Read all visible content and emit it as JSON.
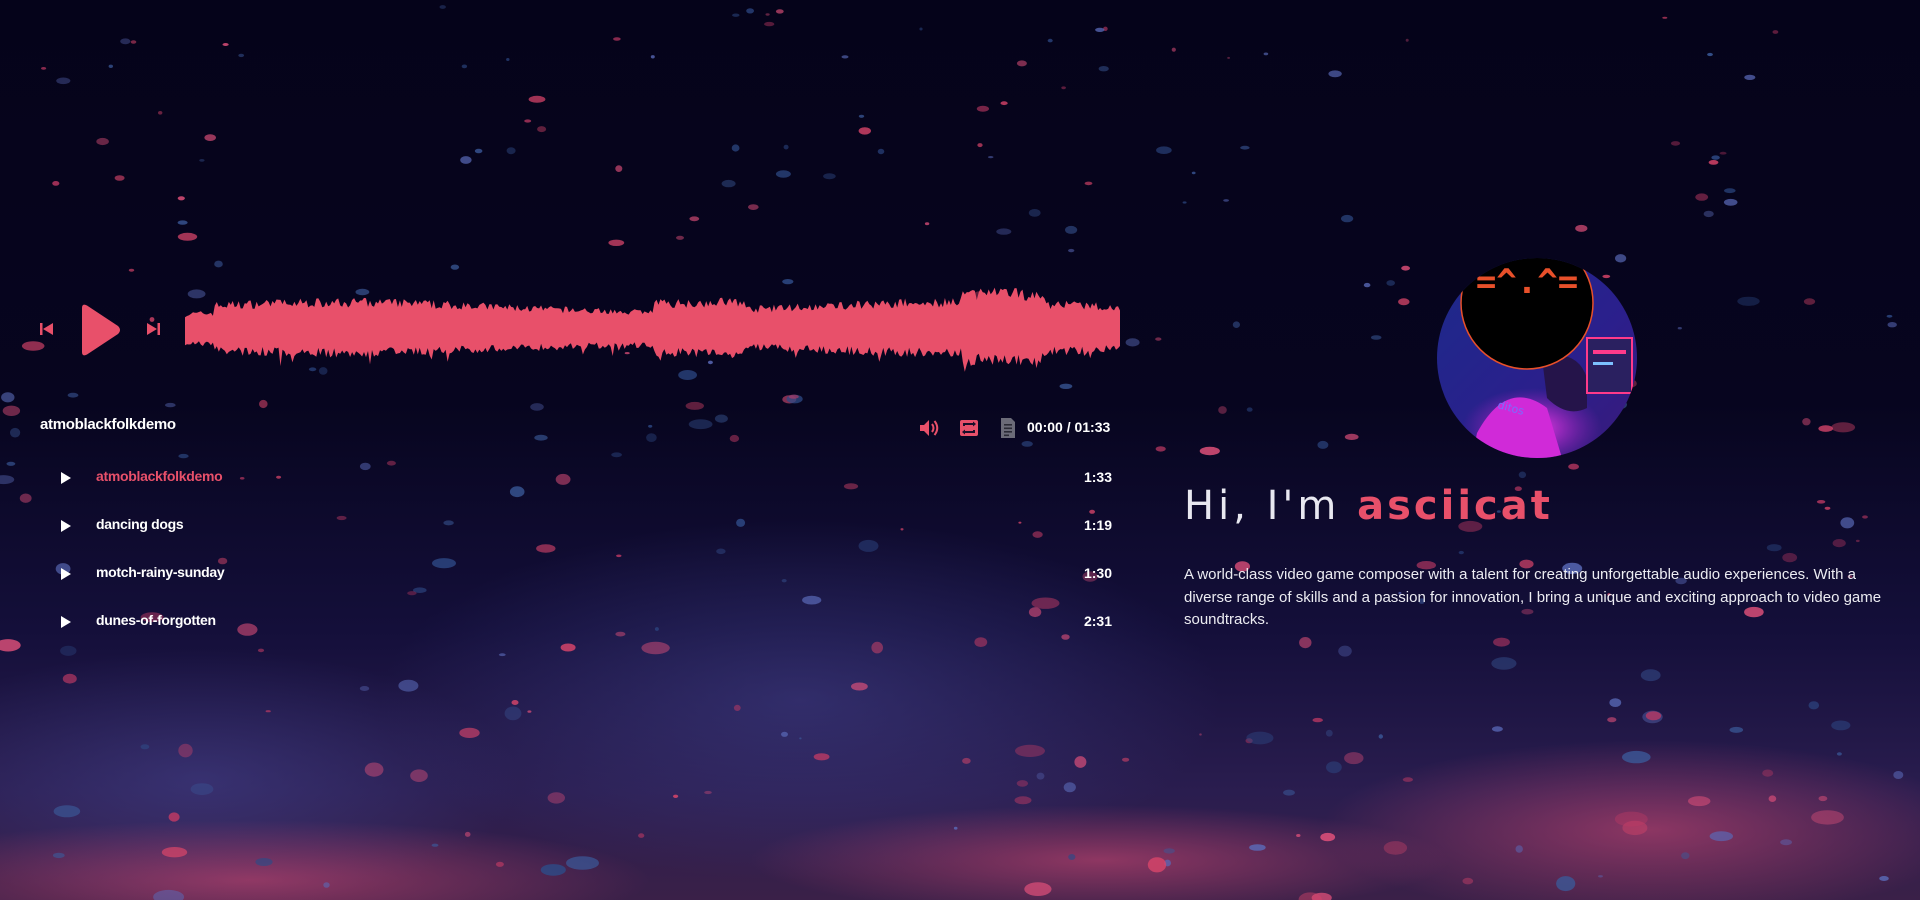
{
  "player": {
    "current_track": "atmoblackfolkdemo",
    "time_current": "00:00",
    "time_total": "01:33",
    "accent_color": "#e8506a"
  },
  "playlist": [
    {
      "title": "atmoblackfolkdemo",
      "duration": "1:33",
      "active": true
    },
    {
      "title": "dancing dogs",
      "duration": "1:19",
      "active": false
    },
    {
      "title": "motch-rainy-sunday",
      "duration": "1:30",
      "active": false
    },
    {
      "title": "dunes-of-forgotten",
      "duration": "2:31",
      "active": false
    }
  ],
  "profile": {
    "greeting": "Hi, I'm",
    "name": "asciicat",
    "avatar_logo": "=^.^=",
    "bio": "A world-class video game composer with a talent for creating unforgettable audio experiences. With a diverse range of skills and a passion for innovation, I bring a unique and exciting approach to video game soundtracks."
  },
  "icons": {
    "prev": "skip-previous-icon",
    "play": "play-icon",
    "next": "skip-next-icon",
    "volume": "volume-icon",
    "repeat": "repeat-icon",
    "playlist": "playlist-icon"
  },
  "colors": {
    "background": "#06041a",
    "accent": "#e8506a",
    "text": "#ffffff"
  }
}
